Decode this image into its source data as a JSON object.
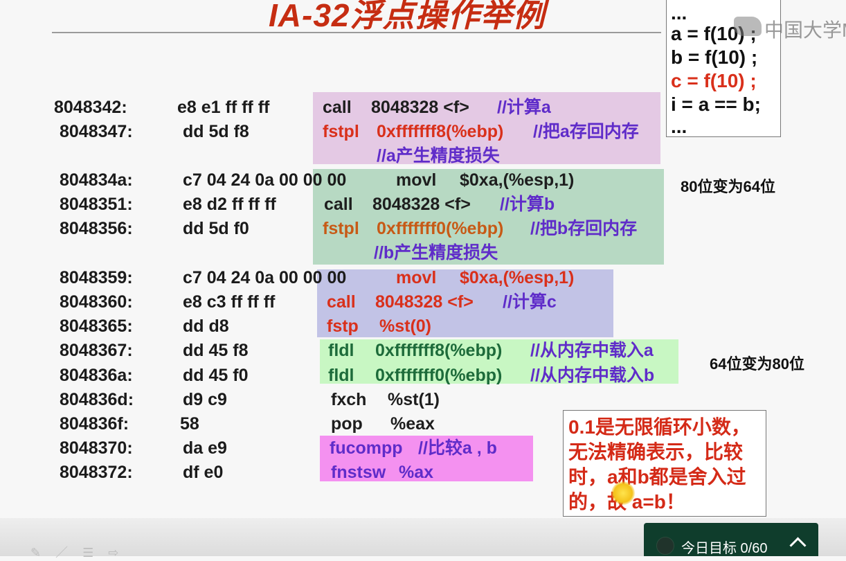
{
  "slide": {
    "title": "IA-32浮点操作举例"
  },
  "code_box": {
    "lines": [
      "...",
      "a = f(10) ;",
      "b = f(10) ;",
      "c = f(10) ;",
      "i = a == b;",
      "..."
    ]
  },
  "watermark": {
    "text": "中国大学M"
  },
  "rows": [
    {
      "addr": "8048342:",
      "hex": "e8 e1 ff ff ff",
      "op": "call",
      "arg": "8048328 <f>",
      "comment": "//计算a"
    },
    {
      "addr": "8048347:",
      "hex": "dd 5d f8",
      "op": "fstpl",
      "arg": "0xfffffff8(%ebp)",
      "comment": "//把a存回内存"
    },
    {
      "addr": "",
      "hex": "",
      "op": "",
      "arg": "",
      "comment": "//a产生精度损失"
    },
    {
      "addr": "804834a:",
      "hex": "c7 04 24 0a 00 00 00",
      "op": "movl",
      "arg": "$0xa,(%esp,1)",
      "comment": ""
    },
    {
      "addr": "8048351:",
      "hex": "e8 d2 ff ff ff",
      "op": "call",
      "arg": "8048328 <f>",
      "comment": "//计算b"
    },
    {
      "addr": "8048356:",
      "hex": "dd 5d f0",
      "op": "fstpl",
      "arg": "0xfffffff0(%ebp)",
      "comment": "//把b存回内存"
    },
    {
      "addr": "",
      "hex": "",
      "op": "",
      "arg": "",
      "comment": "//b产生精度损失"
    },
    {
      "addr": "8048359:",
      "hex": "c7 04 24 0a 00 00 00",
      "op": "movl",
      "arg": "$0xa,(%esp,1)",
      "comment": ""
    },
    {
      "addr": "8048360:",
      "hex": "e8 c3 ff ff ff",
      "op": "call",
      "arg": "8048328 <f>",
      "comment": "//计算c"
    },
    {
      "addr": "8048365:",
      "hex": "dd d8",
      "op": "fstp",
      "arg": "%st(0)",
      "comment": ""
    },
    {
      "addr": "8048367:",
      "hex": "dd 45 f8",
      "op": "fldl",
      "arg": "0xfffffff8(%ebp)",
      "comment": "//从内存中载入a"
    },
    {
      "addr": "804836a:",
      "hex": "dd 45 f0",
      "op": "fldl",
      "arg": "0xfffffff0(%ebp)",
      "comment": "//从内存中载入b"
    },
    {
      "addr": "804836d:",
      "hex": "d9 c9",
      "op": "fxch",
      "arg": "%st(1)",
      "comment": ""
    },
    {
      "addr": "804836f:",
      "hex": "58",
      "op": "pop",
      "arg": "%eax",
      "comment": ""
    },
    {
      "addr": "8048370:",
      "hex": "da e9",
      "op": "fucompp",
      "arg": "",
      "comment": "//比较a , b"
    },
    {
      "addr": "8048372:",
      "hex": "df e0",
      "op": "fnstsw",
      "arg": "%ax",
      "comment": ""
    }
  ],
  "notes": {
    "store_note": "80位变为64位",
    "load_note": "64位变为80位"
  },
  "explanation": {
    "lines": [
      "0.1是无限循环小数，",
      "无法精确表示，比较",
      "时，a和b都是舍入过",
      "的，故 a=b！"
    ]
  },
  "bottom": {
    "toolbar_icons": "✎ ／ ☰ ⇨",
    "goal_label": "今日目标 0/60"
  },
  "colors": {
    "title": "#c62d12",
    "red_text": "#d9301b",
    "purple_text": "#5f2cc9",
    "goal_widget_bg": "#0f3d2c"
  }
}
